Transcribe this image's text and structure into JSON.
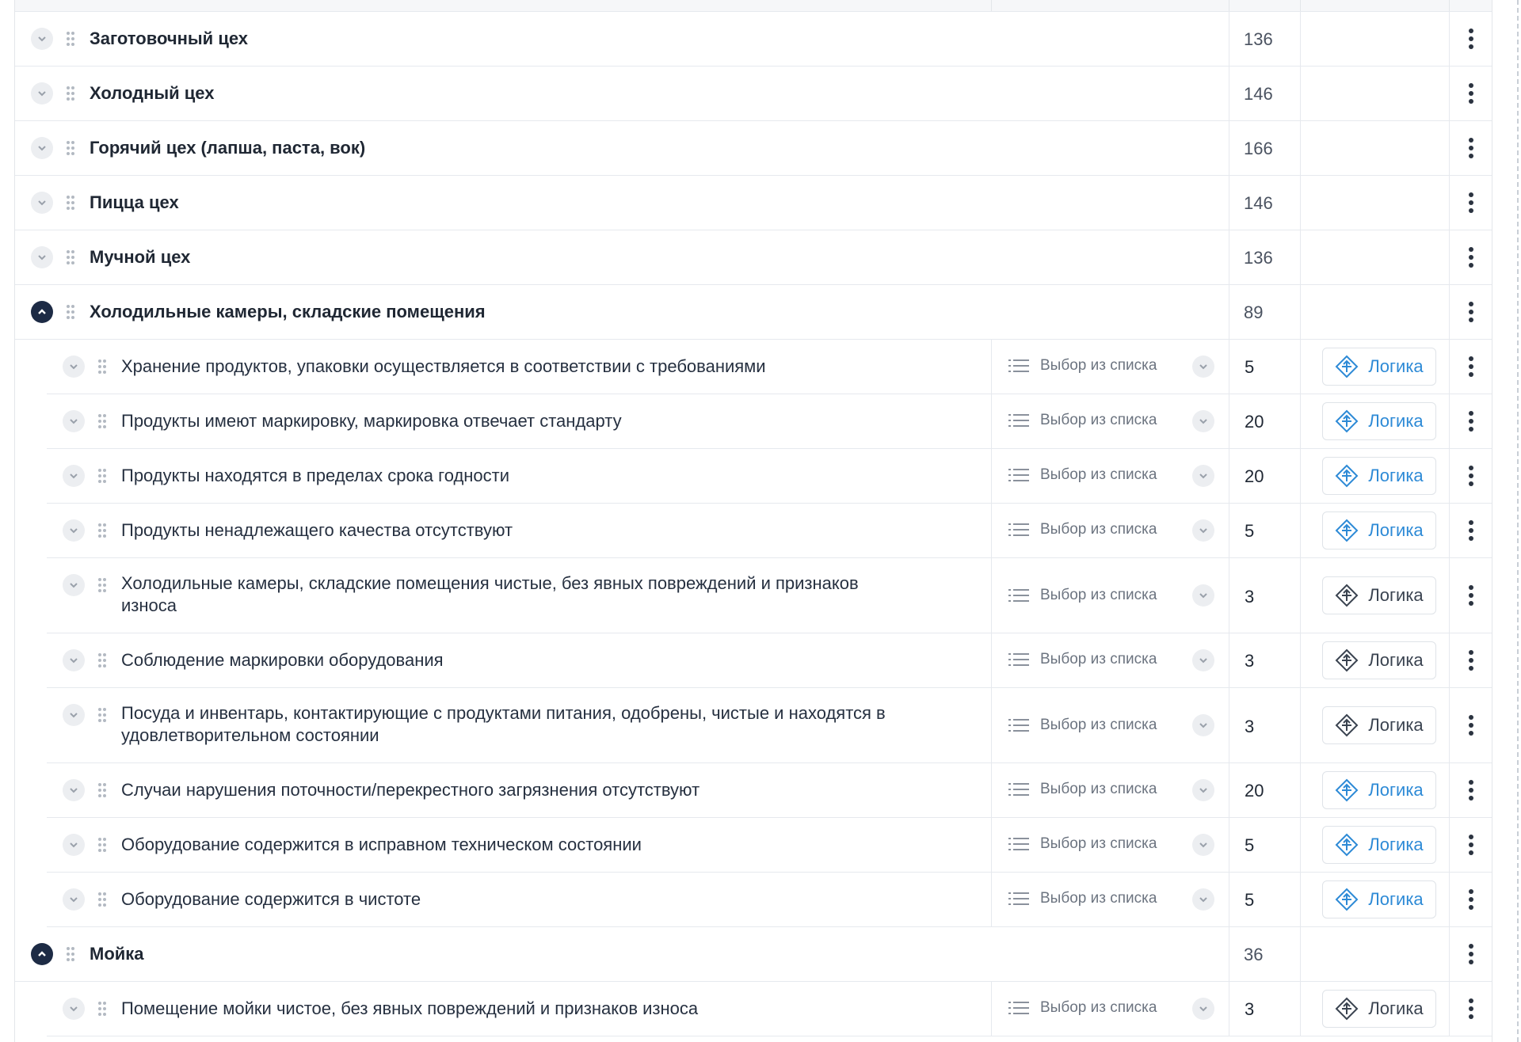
{
  "type_label": "Выбор из списка",
  "logic_label": "Логика",
  "colors": {
    "active_logic": "#2d8ad6",
    "inactive_logic": "#3a4350",
    "expanded_chevron": "#1d2b45"
  },
  "groups": [
    {
      "title": "Заготовочный цех",
      "score": "136",
      "expanded": false
    },
    {
      "title": "Холодный цех",
      "score": "146",
      "expanded": false
    },
    {
      "title": "Горячий цех (лапша, паста, вок)",
      "score": "166",
      "expanded": false
    },
    {
      "title": "Пицца цех",
      "score": "146",
      "expanded": false
    },
    {
      "title": "Мучной цех",
      "score": "136",
      "expanded": false
    },
    {
      "title": "Холодильные камеры, складские помещения",
      "score": "89",
      "expanded": true
    },
    {
      "title": "Мойка",
      "score": "36",
      "expanded": true
    }
  ],
  "items": [
    {
      "text": "Хранение продуктов, упаковки осуществляется в соответствии с требованиями",
      "score": "5",
      "logic_active": true
    },
    {
      "text": "Продукты имеют маркировку, маркировка отвечает стандарту",
      "score": "20",
      "logic_active": true
    },
    {
      "text": "Продукты находятся в пределах срока годности",
      "score": "20",
      "logic_active": true
    },
    {
      "text": "Продукты ненадлежащего качества отсутствуют",
      "score": "5",
      "logic_active": true
    },
    {
      "text": "Холодильные камеры, складские помещения чистые, без явных повреждений и признаков",
      "text2": "износа",
      "score": "3",
      "logic_active": false
    },
    {
      "text": "Соблюдение маркировки оборудования",
      "score": "3",
      "logic_active": false
    },
    {
      "text": "Посуда и инвентарь, контактирующие с продуктами питания, одобрены, чистые и находятся в",
      "text2": "удовлетворительном состоянии",
      "score": "3",
      "logic_active": false
    },
    {
      "text": "Случаи нарушения поточности/перекрестного загрязнения отсутствуют",
      "score": "20",
      "logic_active": true
    },
    {
      "text": "Оборудование содержится в исправном техническом состоянии",
      "score": "5",
      "logic_active": true
    },
    {
      "text": "Оборудование содержится в чистоте",
      "score": "5",
      "logic_active": true
    },
    {
      "text": "Помещение мойки чистое, без явных повреждений и признаков износа",
      "score": "3",
      "logic_active": false
    }
  ]
}
